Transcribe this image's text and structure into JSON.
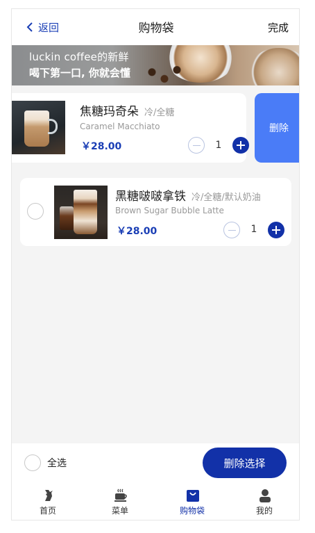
{
  "nav": {
    "back_label": "返回",
    "title": "购物袋",
    "done_label": "完成"
  },
  "banner": {
    "line1": "luckin coffee的新鲜",
    "line2": "喝下第一口, 你就会懂"
  },
  "items": [
    {
      "name": "焦糖玛奇朵",
      "spec": "冷/全糖",
      "en": "Caramel Macchiato",
      "price": "￥28.00",
      "qty": "1",
      "delete_label": "删除"
    },
    {
      "name": "黑糖啵啵拿铁",
      "spec": "冷/全糖/默认奶油",
      "en": "Brown Sugar Bubble Latte",
      "price": "￥28.00",
      "qty": "1"
    }
  ],
  "footer": {
    "select_all": "全选",
    "delete_selected": "删除选择"
  },
  "tabs": [
    {
      "label": "首页",
      "icon": "deer-logo-icon",
      "active": false
    },
    {
      "label": "菜单",
      "icon": "coffee-cup-icon",
      "active": false
    },
    {
      "label": "购物袋",
      "icon": "shopping-bag-icon",
      "active": true
    },
    {
      "label": "我的",
      "icon": "user-icon",
      "active": false
    }
  ],
  "colors": {
    "accent": "#1231a8",
    "swipe_delete": "#4a7cf7",
    "background": "#f4f4f4"
  }
}
